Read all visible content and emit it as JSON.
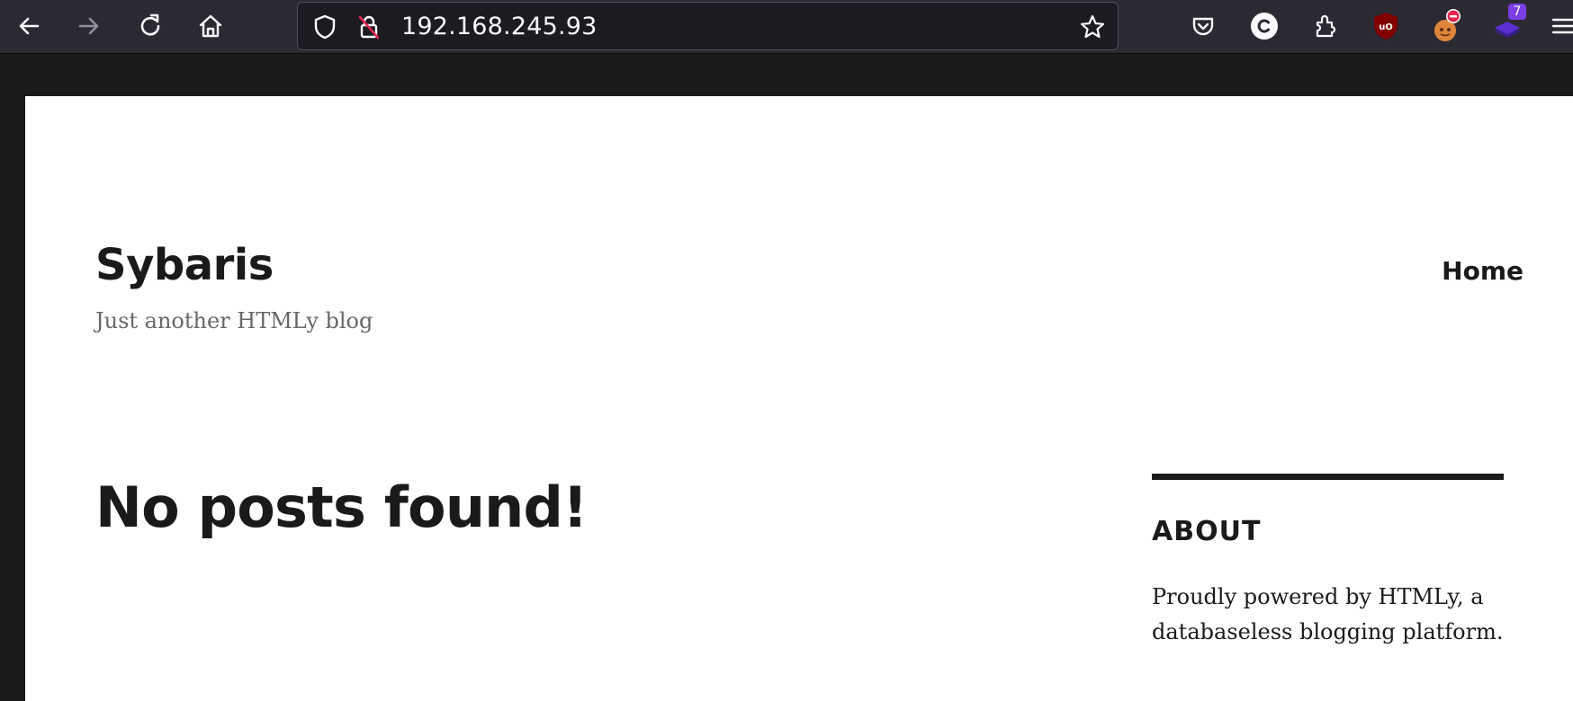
{
  "browser": {
    "url": "192.168.245.93",
    "icons": {
      "back": "arrow-left-icon",
      "forward": "arrow-right-icon",
      "reload": "reload-icon",
      "home": "home-icon",
      "tracking": "shield-icon",
      "insecure": "lock-strikethrough-icon",
      "bookmark": "star-icon",
      "pocket": "pocket-icon",
      "extensions": "puzzle-icon",
      "menu": "hamburger-menu-icon"
    },
    "extension_badge": "7"
  },
  "site": {
    "title": "Sybaris",
    "description": "Just another HTMLy blog",
    "nav": {
      "home": "Home"
    }
  },
  "main": {
    "heading": "No posts found!"
  },
  "sidebar": {
    "about": {
      "title": "ABOUT",
      "text": "Proudly powered by HTMLy, a databaseless blogging platform."
    }
  },
  "colors": {
    "toolbar_bg": "#2b2a33",
    "page_bg": "#ffffff",
    "text": "#1a1a1a",
    "muted_text": "#686868"
  }
}
